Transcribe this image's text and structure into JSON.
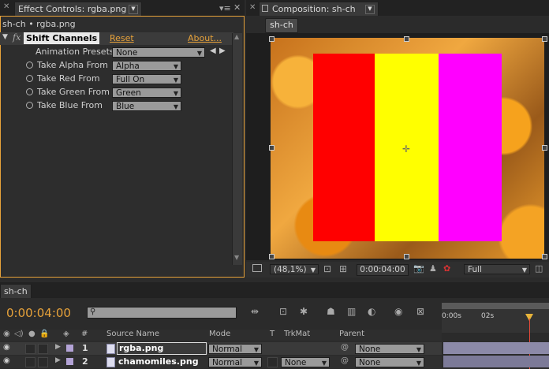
{
  "effect_panel": {
    "tab_title": "Effect Controls: rgba.png",
    "breadcrumb": "sh-ch • rgba.png",
    "effect_name": "Shift Channels",
    "reset_label": "Reset",
    "about_label": "About...",
    "presets_label": "Animation Presets:",
    "presets_value": "None",
    "params": [
      {
        "label": "Take Alpha From",
        "value": "Alpha"
      },
      {
        "label": "Take Red From",
        "value": "Full On"
      },
      {
        "label": "Take Green From",
        "value": "Green"
      },
      {
        "label": "Take Blue From",
        "value": "Blue"
      }
    ]
  },
  "comp_panel": {
    "tab_title": "Composition: sh-ch",
    "comp_tab": "sh-ch",
    "zoom": "(48,1%)",
    "timecode": "0:00:04:00",
    "resolution": "Full",
    "stripe_colors": [
      "#ff0000",
      "#ffff00",
      "#ff00ff"
    ]
  },
  "timeline": {
    "tab_title": "sh-ch",
    "timecode": "0:00:04:00",
    "search_placeholder": "",
    "columns": {
      "hash": "#",
      "source": "Source Name",
      "mode": "Mode",
      "t": "T",
      "trkmat": "TrkMat",
      "parent": "Parent"
    },
    "ruler": {
      "t0": "0:00s",
      "t1": "02s"
    },
    "layers": [
      {
        "num": "1",
        "name": "rgba.png",
        "mode": "Normal",
        "trkmat": "",
        "parent": "None",
        "label_color": "#b3a3d6"
      },
      {
        "num": "2",
        "name": "chamomiles.png",
        "mode": "Normal",
        "trkmat": "None",
        "parent": "None",
        "label_color": "#b3a3d6"
      }
    ]
  }
}
